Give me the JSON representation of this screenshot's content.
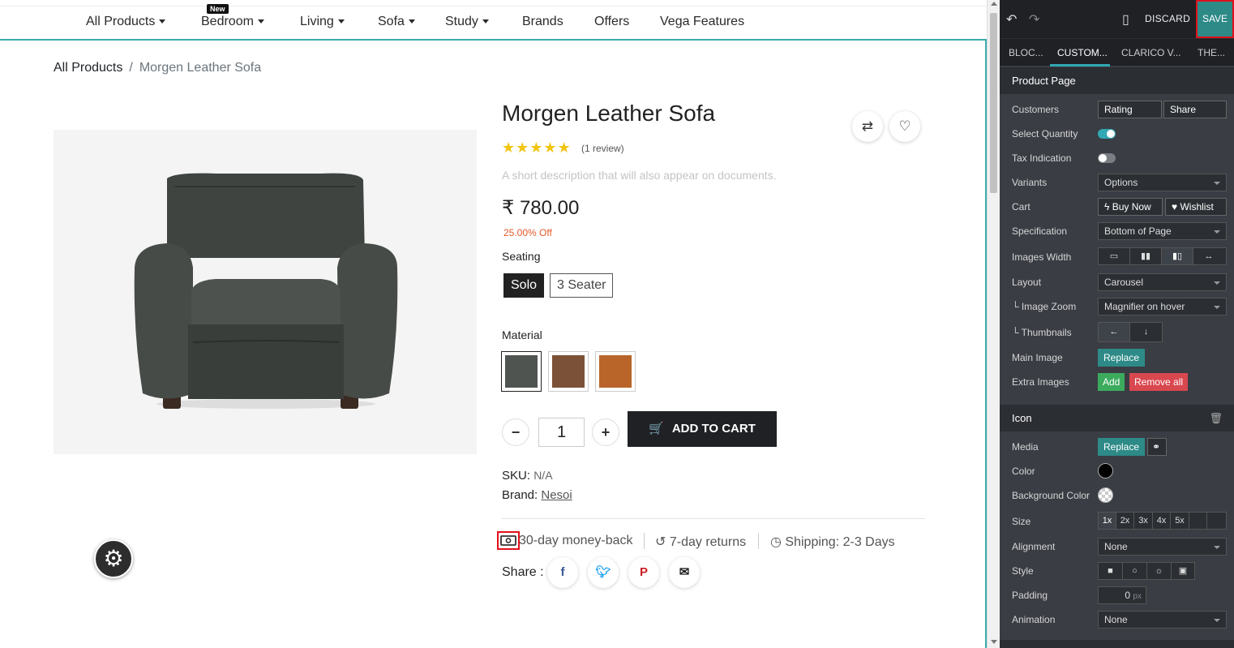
{
  "website": {
    "menu": {
      "items": [
        {
          "label": "All Products",
          "dropdown": true
        },
        {
          "label": "Bedroom",
          "dropdown": true,
          "badge": "New"
        },
        {
          "label": "Living",
          "dropdown": true
        },
        {
          "label": "Sofa",
          "dropdown": true
        },
        {
          "label": "Study",
          "dropdown": true
        },
        {
          "label": "Brands",
          "dropdown": false
        },
        {
          "label": "Offers",
          "dropdown": false
        },
        {
          "label": "Vega Features",
          "dropdown": false
        }
      ]
    },
    "breadcrumb": {
      "parent": "All Products",
      "separator": "/",
      "current": "Morgen Leather Sofa"
    },
    "product": {
      "title": "Morgen Leather Sofa",
      "rating_stars": 5,
      "review_count": "(1 review)",
      "short_description": "A short description that will also appear on documents.",
      "price": "₹ 780.00",
      "discount": "25.00% Off",
      "seating_label": "Seating",
      "seating_options": [
        {
          "label": "Solo",
          "selected": true
        },
        {
          "label": "3 Seater",
          "selected": false
        }
      ],
      "material_label": "Material",
      "material_swatches": [
        {
          "color": "#505451",
          "selected": true
        },
        {
          "color": "#7b5238",
          "selected": false
        },
        {
          "color": "#b9652a",
          "selected": false
        }
      ],
      "quantity": "1",
      "add_to_cart": "ADD TO CART",
      "sku_label": "SKU:",
      "sku_value": "N/A",
      "brand_label": "Brand:",
      "brand_value": "Nesoi",
      "features": [
        "30-day money-back",
        "7-day returns",
        "Shipping: 2-3 Days"
      ],
      "share_label": "Share :"
    },
    "colors": {
      "accent_frame": "#3aadaa",
      "discount": "#e55a2b",
      "stars": "#f1c40f"
    }
  },
  "editor": {
    "toolbar": {
      "discard_label": "DISCARD",
      "save_label": "SAVE"
    },
    "tabs": [
      {
        "label": "BLOC...",
        "active": false
      },
      {
        "label": "CUSTOM...",
        "active": true
      },
      {
        "label": "CLARICO V...",
        "active": false
      },
      {
        "label": "THE...",
        "active": false
      }
    ],
    "product_page": {
      "title": "Product Page",
      "customers": {
        "label": "Customers",
        "options": [
          "Rating",
          "Share"
        ]
      },
      "select_quantity": {
        "label": "Select Quantity",
        "on": true
      },
      "tax_indication": {
        "label": "Tax Indication",
        "on": false
      },
      "variants": {
        "label": "Variants",
        "value": "Options"
      },
      "cart": {
        "label": "Cart",
        "buy_now": "Buy Now",
        "wishlist": "Wishlist"
      },
      "specification": {
        "label": "Specification",
        "value": "Bottom of Page"
      },
      "images_width": {
        "label": "Images Width"
      },
      "layout": {
        "label": "Layout",
        "value": "Carousel"
      },
      "image_zoom": {
        "label": "└ Image Zoom",
        "value": "Magnifier on hover"
      },
      "thumbnails": {
        "label": "└ Thumbnails"
      },
      "main_image": {
        "label": "Main Image",
        "replace": "Replace"
      },
      "extra_images": {
        "label": "Extra Images",
        "add": "Add",
        "remove_all": "Remove all"
      }
    },
    "icon": {
      "title": "Icon",
      "media": {
        "label": "Media",
        "replace": "Replace"
      },
      "color": {
        "label": "Color",
        "value": "#000000"
      },
      "background_color": {
        "label": "Background Color"
      },
      "size": {
        "label": "Size",
        "options": [
          "1x",
          "2x",
          "3x",
          "4x",
          "5x"
        ],
        "selected": "1x"
      },
      "alignment": {
        "label": "Alignment",
        "value": "None"
      },
      "style": {
        "label": "Style"
      },
      "padding": {
        "label": "Padding",
        "value": "0",
        "unit": "px"
      },
      "animation": {
        "label": "Animation",
        "value": "None"
      }
    },
    "colors": {
      "panel_bg": "#3a3d44",
      "save_bg": "#2d8a87",
      "toggle_on": "#31a8b3"
    }
  }
}
